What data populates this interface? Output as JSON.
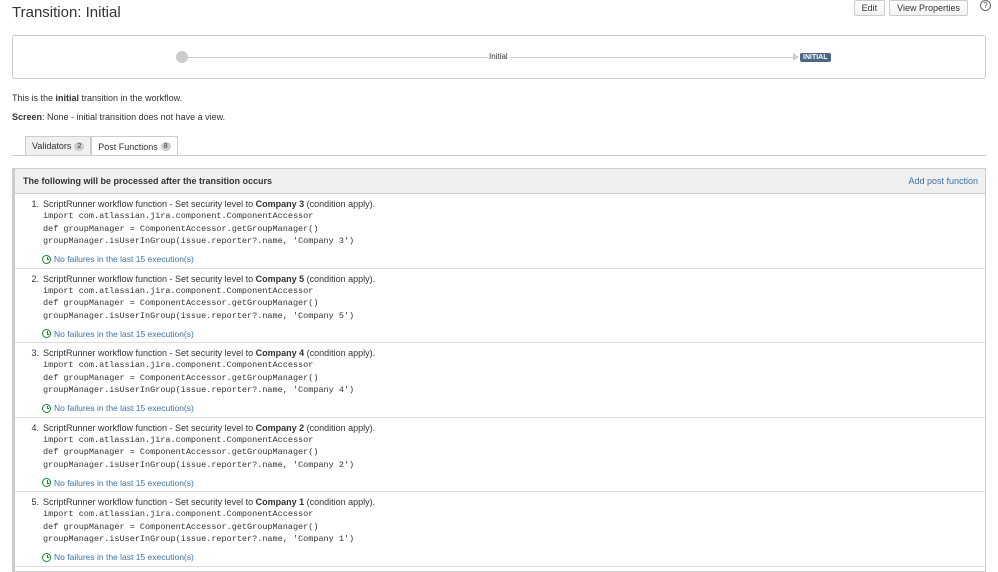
{
  "page": {
    "title": "Transition: Initial"
  },
  "actions": {
    "edit_label": "Edit",
    "view_properties_label": "View Properties",
    "help_glyph": "?"
  },
  "diagram": {
    "transition_label": "Initial",
    "status_label": "INITIAL",
    "status_color": "#4a6785"
  },
  "description": {
    "prefix": "This is the ",
    "bold": "initial",
    "suffix": " transition in the workflow.",
    "screen_label": "Screen",
    "screen_value": ": None - initial transition does not have a view."
  },
  "tabs": [
    {
      "label": "Validators",
      "count": "2",
      "active": false
    },
    {
      "label": "Post Functions",
      "count": "8",
      "active": true
    }
  ],
  "panel": {
    "title": "The following will be processed after the transition occurs",
    "add_link": "Add post function"
  },
  "post_functions": [
    {
      "num": "1.",
      "text_prefix": "ScriptRunner workflow function - Set security level to ",
      "company": "Company 3",
      "text_suffix": " (condition apply).",
      "code1": "import com.atlassian.jira.component.ComponentAccessor",
      "code2": "def groupManager = ComponentAccessor.getGroupManager()",
      "code3": "groupManager.isUserInGroup(issue.reporter?.name, 'Company 3')",
      "status": "No failures in the last 15 execution(s)"
    },
    {
      "num": "2.",
      "text_prefix": "ScriptRunner workflow function - Set security level to ",
      "company": "Company 5",
      "text_suffix": " (condition apply).",
      "code1": "import com.atlassian.jira.component.ComponentAccessor",
      "code2": "def groupManager = ComponentAccessor.getGroupManager()",
      "code3": "groupManager.isUserInGroup(issue.reporter?.name, 'Company 5')",
      "status": "No failures in the last 15 execution(s)"
    },
    {
      "num": "3.",
      "text_prefix": "ScriptRunner workflow function - Set security level to ",
      "company": "Company 4",
      "text_suffix": " (condition apply).",
      "code1": "import com.atlassian.jira.component.ComponentAccessor",
      "code2": "def groupManager = ComponentAccessor.getGroupManager()",
      "code3": "groupManager.isUserInGroup(issue.reporter?.name, 'Company 4')",
      "status": "No failures in the last 15 execution(s)"
    },
    {
      "num": "4.",
      "text_prefix": "ScriptRunner workflow function - Set security level to ",
      "company": "Company 2",
      "text_suffix": " (condition apply).",
      "code1": "import com.atlassian.jira.component.ComponentAccessor",
      "code2": "def groupManager = ComponentAccessor.getGroupManager()",
      "code3": "groupManager.isUserInGroup(issue.reporter?.name, 'Company 2')",
      "status": "No failures in the last 15 execution(s)"
    },
    {
      "num": "5.",
      "text_prefix": "ScriptRunner workflow function - Set security level to ",
      "company": "Company 1",
      "text_suffix": " (condition apply).",
      "code1": "import com.atlassian.jira.component.ComponentAccessor",
      "code2": "def groupManager = ComponentAccessor.getGroupManager()",
      "code3": "groupManager.isUserInGroup(issue.reporter?.name, 'Company 1')",
      "status": "No failures in the last 15 execution(s)"
    }
  ]
}
